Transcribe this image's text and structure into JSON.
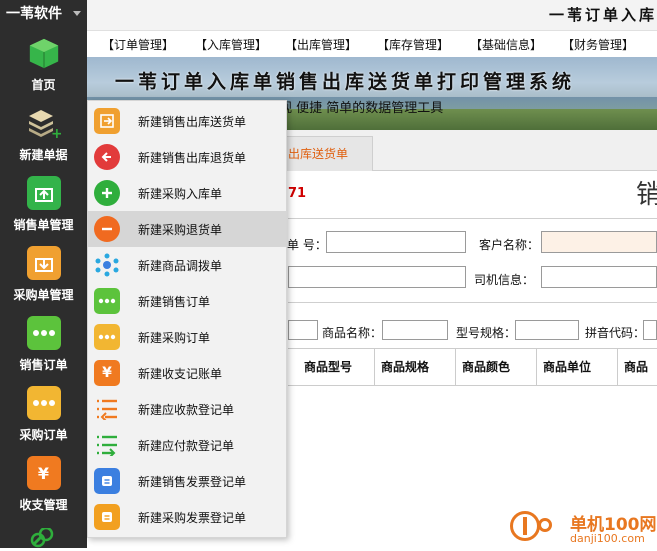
{
  "app": {
    "name": "一苇软件",
    "title_right": "一苇订单入库"
  },
  "sidebar": {
    "items": [
      {
        "label": "首页",
        "icon": "box-icon",
        "color": "#2fb344"
      },
      {
        "label": "新建单据",
        "icon": "layers-plus-icon",
        "color": "#2d2d2d"
      },
      {
        "label": "销售单管理",
        "icon": "box-upload-icon",
        "color": "#33b34a"
      },
      {
        "label": "采购单管理",
        "icon": "box-download-icon",
        "color": "#f0a030"
      },
      {
        "label": "销售订单",
        "icon": "chat-dots-icon",
        "color": "#5cc33c"
      },
      {
        "label": "采购订单",
        "icon": "chat-dots-icon",
        "color": "#f2b632"
      },
      {
        "label": "收支管理",
        "icon": "yen-icon",
        "color": "#f07a20"
      }
    ]
  },
  "menubar": {
    "items": [
      "【订单管理】",
      "【入库管理】",
      "【出库管理】",
      "【库存管理】",
      "【基础信息】",
      "【财务管理】"
    ]
  },
  "banner": {
    "title": "一苇订单入库单销售出库送货单打印管理系统",
    "subtitle": "观 便捷 简单的数据管理工具"
  },
  "tab": {
    "label": "出库送货单"
  },
  "form": {
    "order_no_fragment": "71",
    "big_char": "销",
    "field_no_label": "单 号：",
    "customer_label": "客户名称：",
    "driver_label": "司机信息：",
    "product_name_label": "商品名称：",
    "model_label": "型号规格：",
    "pinyin_label": "拼音代码："
  },
  "table": {
    "headers": [
      "商品型号",
      "商品规格",
      "商品颜色",
      "商品单位",
      "商品"
    ]
  },
  "dropdown": {
    "items": [
      {
        "label": "新建销售出库送货单",
        "icon": "export-doc-icon",
        "color": "#f0a030",
        "shape": "square"
      },
      {
        "label": "新建销售出库退货单",
        "icon": "arrow-left-icon",
        "color": "#e23b3b",
        "shape": "circle"
      },
      {
        "label": "新建采购入库单",
        "icon": "plus-icon",
        "color": "#2fae3c",
        "shape": "circle"
      },
      {
        "label": "新建采购退货单",
        "icon": "minus-icon",
        "color": "#f06a20",
        "shape": "circle"
      },
      {
        "label": "新建商品调拨单",
        "icon": "dots-network-icon",
        "color": "#2a8fd8",
        "shape": "square"
      },
      {
        "label": "新建销售订单",
        "icon": "chat-dots-icon",
        "color": "#5cc33c",
        "shape": "square"
      },
      {
        "label": "新建采购订单",
        "icon": "chat-dots-icon",
        "color": "#f2b632",
        "shape": "square"
      },
      {
        "label": "新建收支记账单",
        "icon": "yen-icon",
        "color": "#f07a20",
        "shape": "square"
      },
      {
        "label": "新建应收款登记单",
        "icon": "list-arrow-left-icon",
        "color": "#f07a20",
        "shape": "square"
      },
      {
        "label": "新建应付款登记单",
        "icon": "list-arrow-right-icon",
        "color": "#2fae3c",
        "shape": "square"
      },
      {
        "label": "新建销售发票登记单",
        "icon": "invoice-icon",
        "color": "#3b7fe0",
        "shape": "square"
      },
      {
        "label": "新建采购发票登记单",
        "icon": "invoice-icon",
        "color": "#f2a020",
        "shape": "square"
      }
    ],
    "highlighted_index": 3
  },
  "watermark": {
    "text": "单机100网",
    "url_text": "danji100.com"
  }
}
